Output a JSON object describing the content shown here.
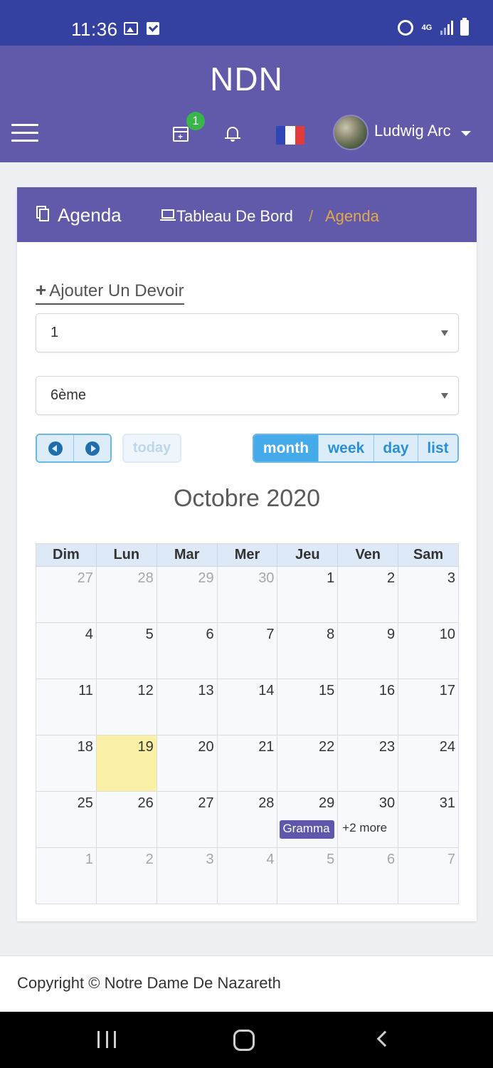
{
  "status_bar": {
    "time": "11:36",
    "network": "4G",
    "icons": [
      "image-icon",
      "check-box-icon",
      "alarm-icon",
      "signal-icon",
      "battery-icon"
    ]
  },
  "app_bar": {
    "title": "NDN",
    "badge_count": "1",
    "user_name": "Ludwig Arc",
    "icons": [
      "hamburger-menu-icon",
      "calendar-plus-icon",
      "bell-icon",
      "french-flag-icon",
      "avatar",
      "caret-down-icon"
    ]
  },
  "card": {
    "title": "Agenda",
    "breadcrumb": {
      "home": "Tableau De Bord",
      "separator": "/",
      "current": "Agenda"
    },
    "add_homework": "Ajouter Un Devoir",
    "select_1": {
      "value": "1"
    },
    "select_2": {
      "value": "6ème"
    },
    "today_label": "today",
    "views": {
      "month": "month",
      "week": "week",
      "day": "day",
      "list": "list"
    },
    "month_title": "Octobre 2020"
  },
  "calendar": {
    "headers": [
      "Dim",
      "Lun",
      "Mar",
      "Mer",
      "Jeu",
      "Ven",
      "Sam"
    ],
    "weeks": [
      [
        "27",
        "28",
        "29",
        "30",
        "1",
        "2",
        "3"
      ],
      [
        "4",
        "5",
        "6",
        "7",
        "8",
        "9",
        "10"
      ],
      [
        "11",
        "12",
        "13",
        "14",
        "15",
        "16",
        "17"
      ],
      [
        "18",
        "19",
        "20",
        "21",
        "22",
        "23",
        "24"
      ],
      [
        "25",
        "26",
        "27",
        "28",
        "29",
        "30",
        "31"
      ],
      [
        "1",
        "2",
        "3",
        "4",
        "5",
        "6",
        "7"
      ]
    ],
    "event_label": "Gramma",
    "more_label": "+2 more"
  },
  "footer": {
    "copyright": "Copyright © Notre Dame De Nazareth"
  },
  "colors": {
    "status_bar": "#3441a0",
    "primary": "#6159aa",
    "breadcrumb_active": "#e0a84e",
    "badge": "#3ab549",
    "button_active": "#44aaea",
    "today_highlight": "#fbf1a6",
    "flag": [
      "#2f46b8",
      "#ffffff",
      "#e23b3b"
    ]
  }
}
